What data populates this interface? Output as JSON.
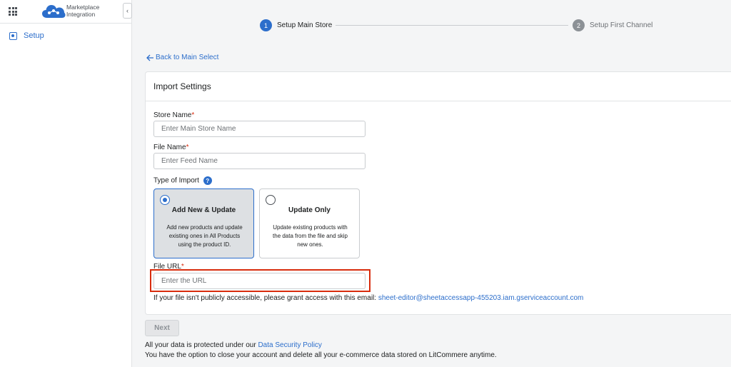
{
  "app": {
    "logo_text_line1": "Marketplace",
    "logo_text_line2": "Integration",
    "collapse_glyph": "‹"
  },
  "sidebar": {
    "items": [
      {
        "label": "Setup",
        "icon": "setup-gear-icon"
      }
    ]
  },
  "stepper": {
    "steps": [
      {
        "number": "1",
        "label": "Setup Main Store",
        "state": "active"
      },
      {
        "number": "2",
        "label": "Setup First Channel",
        "state": "inactive"
      }
    ]
  },
  "back_link": {
    "label": "Back to Main Select"
  },
  "card": {
    "title": "Import Settings",
    "store_name": {
      "label": "Store Name",
      "required": "*",
      "value": "",
      "placeholder": "Enter Main Store Name"
    },
    "file_name": {
      "label": "File Name",
      "required": "*",
      "value": "",
      "placeholder": "Enter Feed Name"
    },
    "import_type": {
      "label": "Type of Import",
      "help_glyph": "?",
      "options": [
        {
          "title": "Add New & Update",
          "description": "Add new products and update existing ones in All Products using the product ID.",
          "selected": true
        },
        {
          "title": "Update Only",
          "description": "Update existing products with the data from the file and skip new ones.",
          "selected": false
        }
      ]
    },
    "file_url": {
      "label": "File URL",
      "required": "*",
      "value": "",
      "placeholder": "Enter the URL"
    },
    "access_note": {
      "text": "If your file isn't publicly accessible, please grant access with this email:",
      "email": "sheet-editor@sheetaccessapp-455203.iam.gserviceaccount.com"
    }
  },
  "next_button": {
    "label": "Next",
    "disabled": true
  },
  "footer": {
    "line1_text": "All your data is protected under our",
    "line1_link": "Data Security Policy",
    "line2_text": "You have the option to close your account and delete all your e-commerce data stored on LitCommere anytime."
  },
  "colors": {
    "accent": "#2c6ecb",
    "required": "#d72c0d",
    "highlight_box": "#d82c0d"
  }
}
